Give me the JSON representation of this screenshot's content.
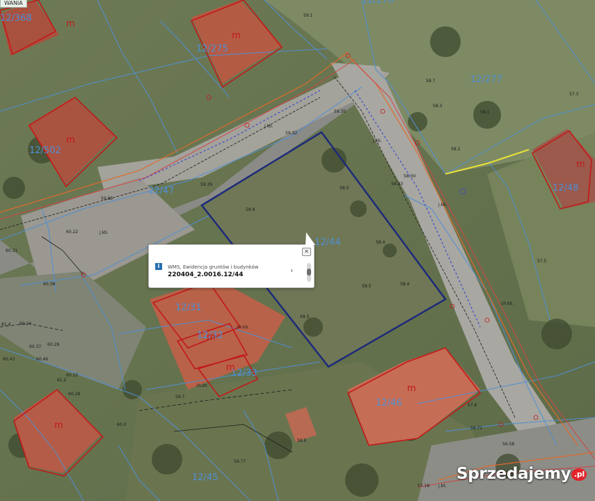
{
  "tab": {
    "label": "WANIA"
  },
  "parcels": [
    {
      "id": "p1",
      "label": "12/368"
    },
    {
      "id": "p2",
      "label": "12/275"
    },
    {
      "id": "p3",
      "label": "12/276"
    },
    {
      "id": "p4",
      "label": "12/277"
    },
    {
      "id": "p5",
      "label": "12/502"
    },
    {
      "id": "p6",
      "label": "22/47"
    },
    {
      "id": "p7",
      "label": "12/44"
    },
    {
      "id": "p8",
      "label": "12/48"
    },
    {
      "id": "p9",
      "label": "12/31"
    },
    {
      "id": "p10",
      "label": "12/32"
    },
    {
      "id": "p11",
      "label": "12/33"
    },
    {
      "id": "p12",
      "label": "12/46"
    },
    {
      "id": "p13",
      "label": "12/45"
    }
  ],
  "building_marker": "m",
  "elevations": [
    "59.1",
    "58.7",
    "58.3",
    "58.1",
    "57.3",
    "58.2",
    "58.5",
    "58.4",
    "58.5",
    "58.43",
    "58.30",
    "58.9",
    "59.30",
    "59.32",
    "59.39",
    "59.85",
    "60.22",
    "60.31",
    "60.38",
    "61.4",
    "60.24",
    "60.37",
    "60.28",
    "60.46",
    "60.43",
    "60.22",
    "60.28",
    "61.2",
    "60.0",
    "59.7",
    "59.77",
    "58.6",
    "58.5",
    "58.4",
    "57.5",
    "57.6",
    "56.71",
    "56.58",
    "57.18"
  ],
  "labels_small": [
    "j.kb.",
    "j.kb.",
    "j.kb.",
    "j.kb.",
    "ch.kb.",
    "ch.kb.",
    "ch.bt.",
    "j.bt."
  ],
  "popup": {
    "layer_name": "WMS, Ewidencja gruntów i budynków",
    "feature_id": "220404_2.0016.12/44",
    "close_glyph": "✕",
    "next_glyph": "›",
    "info_glyph": "i"
  },
  "watermark": {
    "text": "Sprzedajemy",
    "suffix": ".pl"
  },
  "colors": {
    "parcel_line": "#4f8fd4",
    "building_outline": "#c31818",
    "selected_parcel": "#1d2a7a",
    "utility_orange": "#e06a2a",
    "utility_black": "#1a1a1a"
  }
}
